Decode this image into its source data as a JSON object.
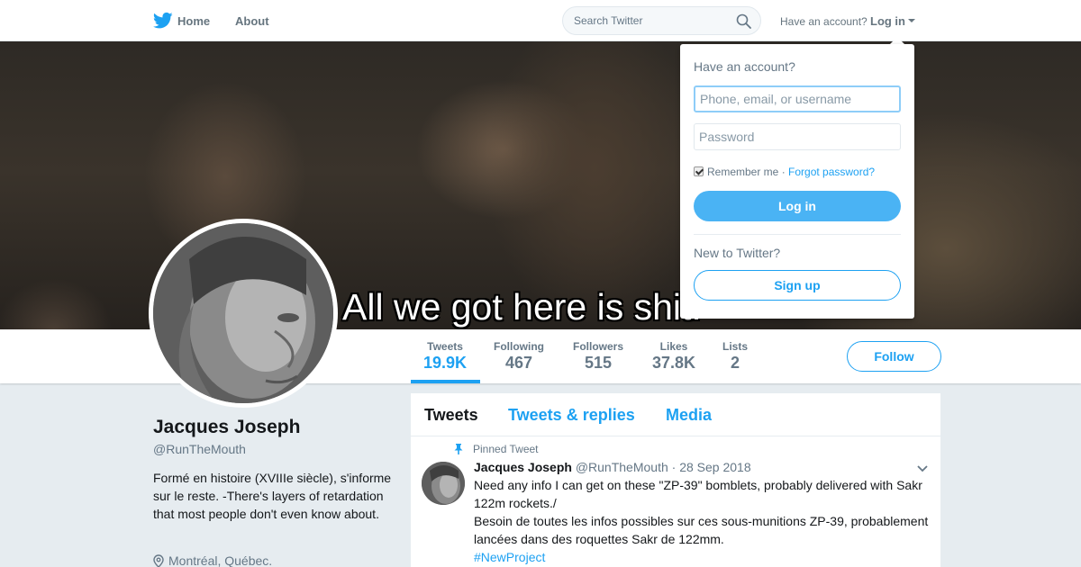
{
  "topnav": {
    "home_label": "Home",
    "about_label": "About",
    "search_placeholder": "Search Twitter",
    "have_account": "Have an account?",
    "login_label": "Log in"
  },
  "banner": {
    "caption": "All we got here is shit."
  },
  "profile": {
    "name": "Jacques Joseph",
    "handle": "@RunTheMouth",
    "bio": "Formé en histoire (XVIIIe siècle), s'informe sur le reste. -There's layers of retardation that most people don't even know about.",
    "location": "Montréal, Québec."
  },
  "stats": [
    {
      "label": "Tweets",
      "value": "19.9K"
    },
    {
      "label": "Following",
      "value": "467"
    },
    {
      "label": "Followers",
      "value": "515"
    },
    {
      "label": "Likes",
      "value": "37.8K"
    },
    {
      "label": "Lists",
      "value": "2"
    }
  ],
  "follow_label": "Follow",
  "timeline": {
    "tabs": [
      "Tweets",
      "Tweets & replies",
      "Media"
    ],
    "pinned_label": "Pinned Tweet",
    "tweet": {
      "name": "Jacques Joseph",
      "handle": "@RunTheMouth",
      "time": "· 28 Sep 2018",
      "text_en": "Need any info I can get on these \"ZP-39\" bomblets, probably delivered with Sakr 122m rockets./",
      "text_fr": "Besoin de toutes les infos possibles sur ces sous-munitions ZP-39, probablement lancées dans des roquettes Sakr de 122mm.",
      "hashtag": "#NewProject"
    }
  },
  "login_dropdown": {
    "title": "Have an account?",
    "username_placeholder": "Phone, email, or username",
    "password_placeholder": "Password",
    "remember_me": "Remember me",
    "separator": " · ",
    "forgot_password": "Forgot password?",
    "login_button": "Log in",
    "new_to_twitter": "New to Twitter?",
    "signup_button": "Sign up"
  },
  "colors": {
    "accent": "#1da1f2",
    "login_button": "#4ab3f4",
    "muted_text": "#657786",
    "page_background": "#e6ecf0"
  }
}
